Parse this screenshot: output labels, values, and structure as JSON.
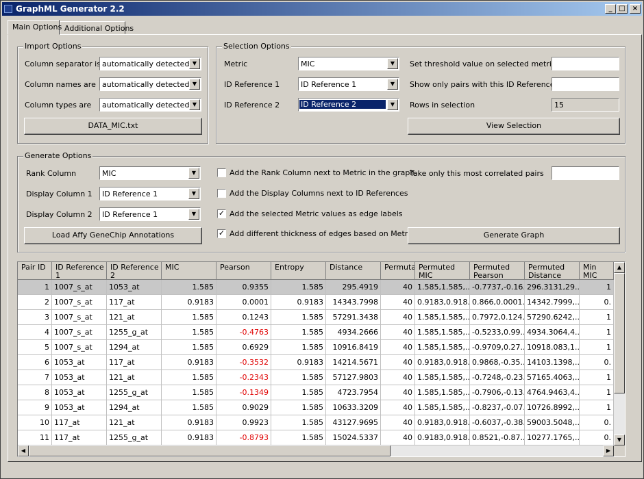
{
  "window": {
    "title": "GraphML Generator 2.2"
  },
  "tabs": [
    {
      "label": "Main Options"
    },
    {
      "label": "Additional Options"
    }
  ],
  "import_options": {
    "legend": "Import Options",
    "column_separator_label": "Column separator is",
    "column_separator_value": "automatically detected",
    "column_names_label": "Column names are",
    "column_names_value": "automatically detected",
    "column_types_label": "Column types are",
    "column_types_value": "automatically detected",
    "file_button": "DATA_MIC.txt"
  },
  "selection_options": {
    "legend": "Selection Options",
    "metric_label": "Metric",
    "metric_value": "MIC",
    "id_ref1_label": "ID Reference 1",
    "id_ref1_value": "ID Reference 1",
    "id_ref2_label": "ID Reference 2",
    "id_ref2_value": "ID Reference 2",
    "threshold_label": "Set threshold value on selected metric",
    "threshold_value": "",
    "pairs_label": "Show only pairs with this ID Reference",
    "pairs_value": "",
    "rows_label": "Rows in selection",
    "rows_value": "15",
    "view_button": "View Selection"
  },
  "generate_options": {
    "legend": "Generate Options",
    "rank_label": "Rank Column",
    "rank_value": "MIC",
    "display1_label": "Display Column 1",
    "display1_value": "ID Reference 1",
    "display2_label": "Display Column 2",
    "display2_value": "ID Reference 1",
    "load_button": "Load Affy GeneChip Annotations",
    "chk1_label": "Add the Rank Column next to Metric in the graph",
    "chk1_checked": "",
    "chk2_label": "Add the Display Columns next to ID References",
    "chk2_checked": "",
    "chk3_label": "Add the selected Metric values as edge labels",
    "chk3_checked": "✓",
    "chk4_label": "Add different thickness of edges based on Metric",
    "chk4_checked": "✓",
    "top_pairs_label": "Take only this most correlated pairs",
    "top_pairs_value": "",
    "generate_button": "Generate Graph"
  },
  "grid": {
    "columns": [
      "Pair ID",
      "ID Reference 1",
      "ID Reference 2",
      "MIC",
      "Pearson",
      "Entropy",
      "Distance",
      "Permutat",
      "Permuted MIC",
      "Permuted Pearson",
      "Permuted Distance",
      "Min MIC"
    ],
    "rows": [
      [
        "1",
        "1007_s_at",
        "1053_at",
        "1.585",
        "0.9355",
        "1.585",
        "295.4919",
        "40",
        "1.585,1.585,...",
        "-0.7737,-0.16...",
        "296.3131,29...",
        "1"
      ],
      [
        "2",
        "1007_s_at",
        "117_at",
        "0.9183",
        "0.0001",
        "0.9183",
        "14343.7998",
        "40",
        "0.9183,0.918...",
        "0.866,0.0001...",
        "14342.7999,...",
        "0."
      ],
      [
        "3",
        "1007_s_at",
        "121_at",
        "1.585",
        "0.1243",
        "1.585",
        "57291.3438",
        "40",
        "1.585,1.585,...",
        "0.7972,0.124...",
        "57290.6242,...",
        "1"
      ],
      [
        "4",
        "1007_s_at",
        "1255_g_at",
        "1.585",
        "-0.4763",
        "1.585",
        "4934.2666",
        "40",
        "1.585,1.585,...",
        "-0.5233,0.99...",
        "4934.3064,4...",
        "1"
      ],
      [
        "5",
        "1007_s_at",
        "1294_at",
        "1.585",
        "0.6929",
        "1.585",
        "10916.8419",
        "40",
        "1.585,1.585,...",
        "-0.9709,0.27...",
        "10918.083,1...",
        "1"
      ],
      [
        "6",
        "1053_at",
        "117_at",
        "0.9183",
        "-0.3532",
        "0.9183",
        "14214.5671",
        "40",
        "0.9183,0.918...",
        "0.9868,-0.35...",
        "14103.1398,...",
        "0."
      ],
      [
        "7",
        "1053_at",
        "121_at",
        "1.585",
        "-0.2343",
        "1.585",
        "57127.9803",
        "40",
        "1.585,1.585,...",
        "-0.7248,-0.23...",
        "57165.4063,...",
        "1"
      ],
      [
        "8",
        "1053_at",
        "1255_g_at",
        "1.585",
        "-0.1349",
        "1.585",
        "4723.7954",
        "40",
        "1.585,1.585,...",
        "-0.7906,-0.13...",
        "4764.9463,4...",
        "1"
      ],
      [
        "9",
        "1053_at",
        "1294_at",
        "1.585",
        "0.9029",
        "1.585",
        "10633.3209",
        "40",
        "1.585,1.585,...",
        "-0.8237,-0.07...",
        "10726.8992,...",
        "1"
      ],
      [
        "10",
        "117_at",
        "121_at",
        "0.9183",
        "0.9923",
        "1.585",
        "43127.9695",
        "40",
        "0.9183,0.918...",
        "-0.6037,-0.38...",
        "59003.5048,...",
        "0."
      ],
      [
        "11",
        "117_at",
        "1255_g_at",
        "0.9183",
        "-0.8793",
        "1.585",
        "15024.5337",
        "40",
        "0.9183,0.918...",
        "0.8521,-0.87...",
        "10277.1765,...",
        "0."
      ]
    ]
  },
  "colors": {
    "negative": "#e00000",
    "title_start": "#0a246a",
    "title_end": "#a6caf0"
  },
  "icons": {
    "minimize": "minimize-icon",
    "maximize": "maximize-icon",
    "close": "close-icon"
  }
}
